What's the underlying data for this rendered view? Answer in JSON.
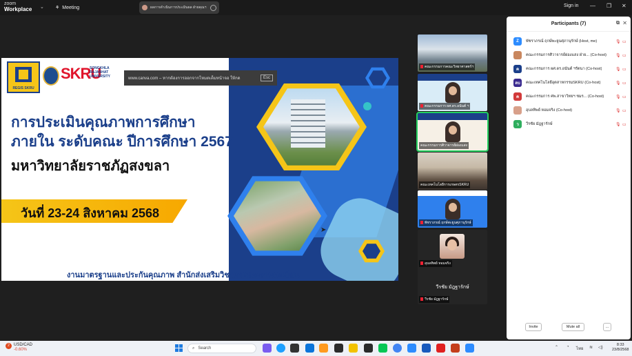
{
  "titlebar": {
    "brand_top": "zoom",
    "brand_bottom": "Workplace",
    "meeting_label": "Meeting",
    "share_tab_label": "ผลการดำเนินการประเมินผล ฝ่ายคุณฯ",
    "signin_label": "Sign in"
  },
  "slide": {
    "canva_notice": "www.canva.com – หากต้องการออกจากโหมดเต็มหน้าจอ ให้กด",
    "esc_label": "Esc",
    "logo1_text": "REGIS SKRU",
    "skru": "SKRU",
    "skru_sub1": "SONGKHLA",
    "skru_sub2": "RAJABHAT",
    "skru_sub3": "UNIVERSITY",
    "title_line1": "การประเมินคุณภาพการศึกษา",
    "title_line2": "ภายใน ระดับคณะ ปีการศึกษา 2567",
    "university": "มหาวิทยาลัยราชภัฏสงขลา",
    "date": "วันที่ 23-24 สิงหาคม 2568",
    "footer": "งานมาตรฐานและประกันคุณภาพ สำนักส่งเสริมวิชาการและงานทะเบียน"
  },
  "video_tiles": [
    {
      "name": "คณะกรรมการคณะวิทยาศาสตร์ฯ"
    },
    {
      "name": "คณะกรรมการ ผศ.ดร.อนันต์ ฯ"
    },
    {
      "name": "คณะกรรมการศิวาจารย์ผ่องแสง"
    },
    {
      "name": "คณะเทคโนโลยีการเกษตรSKRU"
    },
    {
      "name": "พัชราภรณ์ ฤกษ์พะยูนศุภานุรักษ์"
    },
    {
      "name": "อุบลทิพย์ หอมจริง"
    },
    {
      "name": "วีรชัย มัฎฐารักษ์",
      "display": "วีรชัย มัฎฐารักษ์"
    }
  ],
  "participants": {
    "title": "Participants (7)",
    "list": [
      {
        "initial": "Z",
        "color": "#2d8cff",
        "name": "พัชราภรณ์ ฤกษ์พะยูนศุภานุรักษ์ (Host, me)"
      },
      {
        "initial": "",
        "color": "#c9875f",
        "name": "คณะกรรมการศิวาจารย์ผ่องแสง ฝ่าย... (Co-host)"
      },
      {
        "initial": "ค",
        "color": "#1b3f8a",
        "name": "คณะกรรมการ ผศ.ดร.อนันต์ ฯรัตนา (Co-host)"
      },
      {
        "initial": "ลบ",
        "color": "#3a2a8f",
        "name": "คณะเทคโนโลยีอุตสาหกรรมSKRU (Co-host)"
      },
      {
        "initial": "ค",
        "color": "#d23a3a",
        "name": "คณะกรรมการ ศพ.สาขาวิทยฯ ชมร... (Co-host)"
      },
      {
        "initial": "",
        "color": "#d8a08a",
        "name": "อุบลทิพย์ หอมจริง (Co-host)"
      },
      {
        "initial": "ว",
        "color": "#2fae5e",
        "name": "วีรชัย มัฎฐารักษ์"
      }
    ],
    "invite_label": "Invite",
    "mute_all_label": "Mute all",
    "more_label": "..."
  },
  "taskbar": {
    "badge": "2",
    "ticker_pair": "USD/CAD",
    "ticker_change": "-0.60%",
    "search_placeholder": "Search",
    "lang": "ไทย",
    "time": "8:33",
    "date": "23/8/2568"
  }
}
